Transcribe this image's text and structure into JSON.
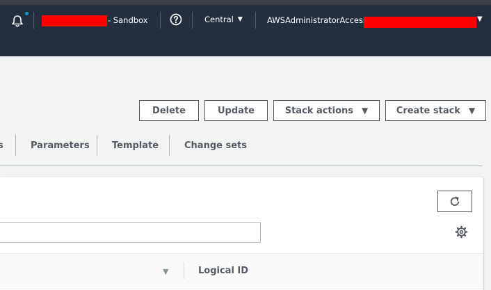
{
  "colors": {
    "nav_background": "#232f3e",
    "page_background": "#f2f3f3",
    "redaction": "#ff0000",
    "notification_dot": "#00a1c9",
    "button_text": "#545b64"
  },
  "topnav": {
    "account_suffix": "- Sandbox",
    "region_label": "Central",
    "region_caret": "▼",
    "role_label": "AWSAdministratorAccess/",
    "role_caret": "▼",
    "icons": [
      "bell-icon",
      "help-icon"
    ]
  },
  "actions": {
    "delete_label": "Delete",
    "update_label": "Update",
    "stack_actions_label": "Stack actions",
    "create_stack_label": "Create stack",
    "caret": "▼"
  },
  "tabs": [
    {
      "label": "s"
    },
    {
      "label": "Parameters"
    },
    {
      "label": "Template"
    },
    {
      "label": "Change sets"
    }
  ],
  "panel": {
    "search_value": "",
    "refresh_icon": "refresh-icon",
    "settings_icon": "gear-icon",
    "table": {
      "sort_icon": "▼",
      "columns": [
        "Logical ID"
      ]
    }
  }
}
